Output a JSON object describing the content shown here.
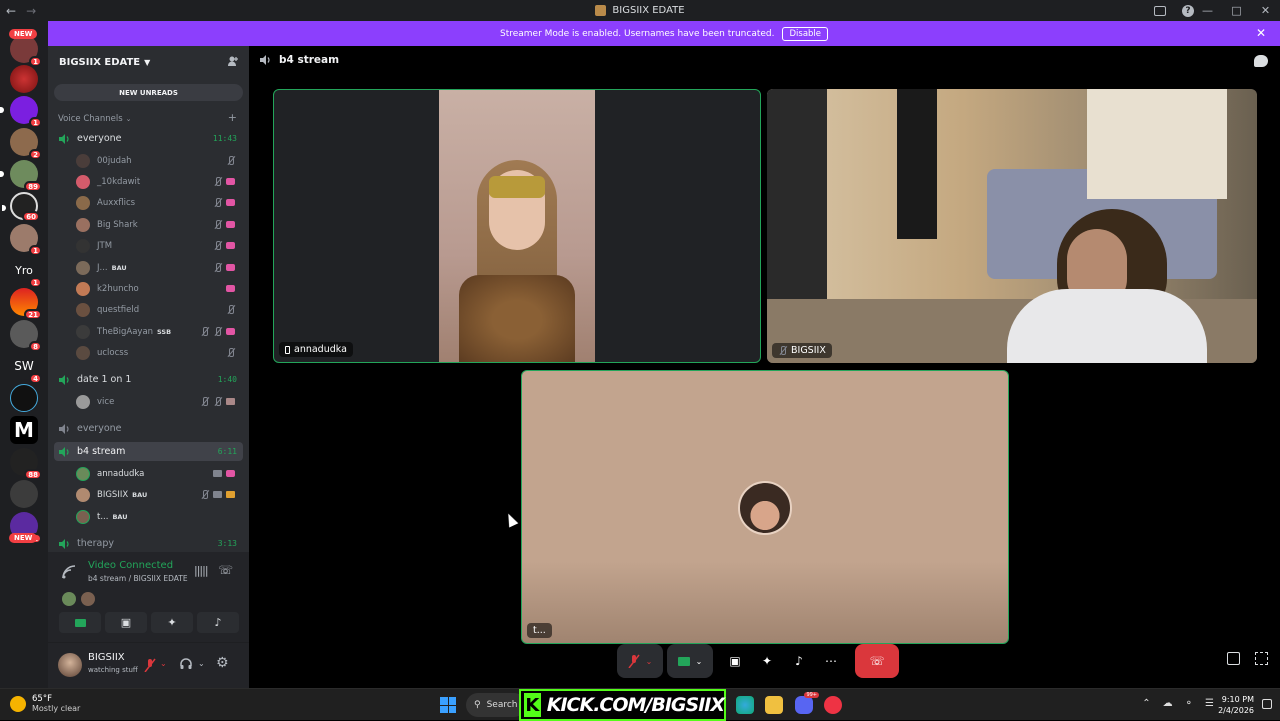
{
  "window": {
    "title": "BIGSIIX EDATE"
  },
  "banner": {
    "text": "Streamer Mode is enabled. Usernames have been truncated.",
    "button": "Disable"
  },
  "server_bar": {
    "new_top": "NEW",
    "new_bottom": "NEW",
    "badges": [
      "1",
      "1",
      "2",
      "89",
      "60",
      "1",
      "1",
      "21",
      "8",
      "4",
      "88",
      "1"
    ],
    "text_icons": [
      "Yro",
      "SW",
      "M"
    ]
  },
  "server": {
    "name": "BIGSIIX EDATE",
    "new_unreads": "NEW UNREADS",
    "category": "Voice Channels"
  },
  "channels": [
    {
      "name": "everyone",
      "time": "11:43",
      "users": [
        {
          "name": "00judah"
        },
        {
          "name": "_10kdawit"
        },
        {
          "name": "Auxxflics"
        },
        {
          "name": "Big Shark"
        },
        {
          "name": "JTM"
        },
        {
          "name": "J...",
          "tag": "BAU"
        },
        {
          "name": "k2huncho"
        },
        {
          "name": "questfield"
        },
        {
          "name": "TheBigAayan",
          "tag": "SSB"
        },
        {
          "name": "uclocss"
        }
      ]
    },
    {
      "name": "date 1 on 1",
      "time": "1:40",
      "users": [
        {
          "name": "vice"
        }
      ]
    },
    {
      "name": "everyone",
      "time": "",
      "users": []
    },
    {
      "name": "b4 stream",
      "time": "6:11",
      "users": [
        {
          "name": "annadudka"
        },
        {
          "name": "BIGSIIX",
          "tag": "BAU"
        },
        {
          "name": "t...",
          "tag": "BAU"
        }
      ]
    },
    {
      "name": "therapy",
      "time": "3:13",
      "users": []
    }
  ],
  "rtc": {
    "status": "Video Connected",
    "location": "b4 stream / BIGSIIX EDATE"
  },
  "user_panel": {
    "name": "BIGSIIX",
    "status": "watching stuff"
  },
  "stage": {
    "channel": "b4 stream",
    "tiles": [
      {
        "label": "annadudka"
      },
      {
        "label": "BIGSIIX"
      },
      {
        "label": "t..."
      }
    ]
  },
  "taskbar": {
    "weather_temp": "65°F",
    "weather_desc": "Mostly clear",
    "search": "Search",
    "overlay": "KICK.COM/BIGSIIX",
    "time": "9:10 PM",
    "date": "2/4/2026",
    "discord_badge": "99+"
  },
  "colors": {
    "brand": "#5865f2",
    "streamer": "#8c3ffd",
    "connected": "#23a55a",
    "danger": "#da373c",
    "kick": "#53fc18"
  }
}
